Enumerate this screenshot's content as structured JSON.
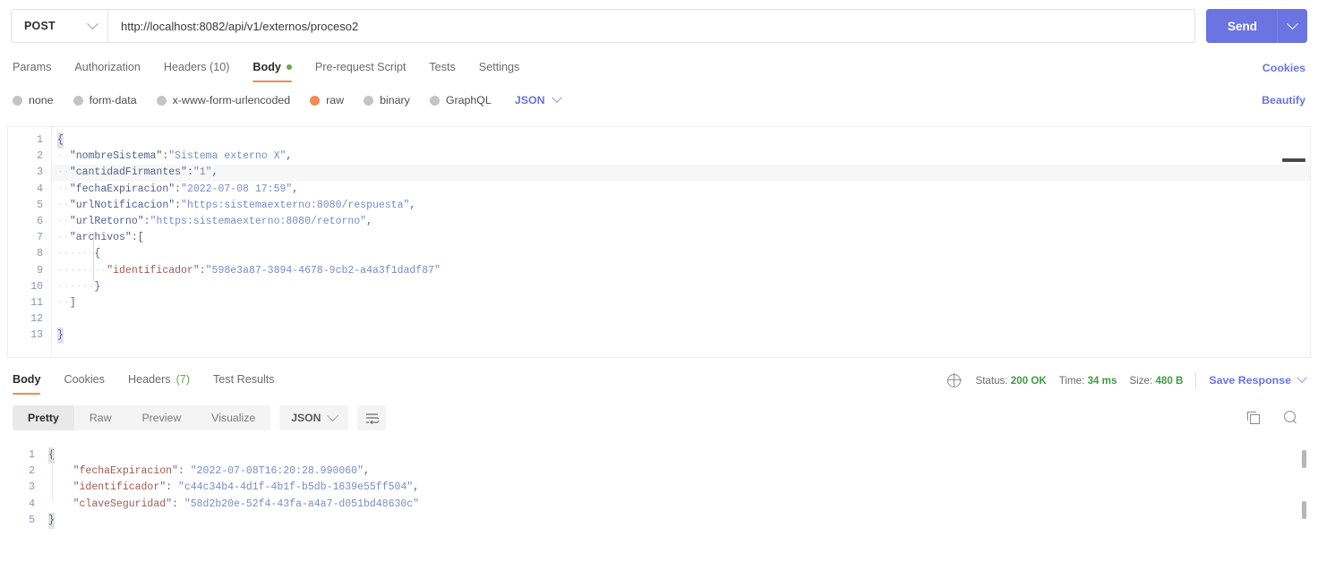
{
  "request_bar": {
    "method": "POST",
    "url": "http://localhost:8082/api/v1/externos/proceso2",
    "send_label": "Send"
  },
  "request_tabs": {
    "items": [
      {
        "label": "Params",
        "active": false
      },
      {
        "label": "Authorization",
        "active": false
      },
      {
        "label": "Headers (10)",
        "active": false
      },
      {
        "label": "Body",
        "active": true,
        "dot": true
      },
      {
        "label": "Pre-request Script",
        "active": false
      },
      {
        "label": "Tests",
        "active": false
      },
      {
        "label": "Settings",
        "active": false
      }
    ],
    "cookies_link": "Cookies"
  },
  "body_type": {
    "options": [
      {
        "label": "none",
        "selected": false
      },
      {
        "label": "form-data",
        "selected": false
      },
      {
        "label": "x-www-form-urlencoded",
        "selected": false
      },
      {
        "label": "raw",
        "selected": true
      },
      {
        "label": "binary",
        "selected": false
      },
      {
        "label": "GraphQL",
        "selected": false
      }
    ],
    "format": "JSON",
    "beautify_link": "Beautify"
  },
  "request_editor": {
    "line_numbers": [
      "1",
      "2",
      "3",
      "4",
      "5",
      "6",
      "7",
      "8",
      "9",
      "10",
      "11",
      "12",
      "13"
    ],
    "lines": [
      {
        "n": 1,
        "content": "{"
      },
      {
        "n": 2,
        "content": "··\"nombreSistema\":\"Sistema externo X\","
      },
      {
        "n": 3,
        "content": "··\"cantidadFirmantes\":\"1\","
      },
      {
        "n": 4,
        "content": "··\"fechaExpiracion\":\"2022-07-08 17:59\","
      },
      {
        "n": 5,
        "content": "··\"urlNotificacion\":\"https:sistemaexterno:8080/respuesta\","
      },
      {
        "n": 6,
        "content": "··\"urlRetorno\":\"https:sistemaexterno:8080/retorno\","
      },
      {
        "n": 7,
        "content": "··\"archivos\":["
      },
      {
        "n": 8,
        "content": "······{"
      },
      {
        "n": 9,
        "content": "········\"identificador\":\"598e3a87-3894-4678-9cb2-a4a3f1dadf87\""
      },
      {
        "n": 10,
        "content": "······}"
      },
      {
        "n": 11,
        "content": "··]"
      },
      {
        "n": 12,
        "content": ""
      },
      {
        "n": 13,
        "content": "}"
      }
    ],
    "keys": {
      "nombreSistema": "\"nombreSistema\"",
      "cantidadFirmantes": "\"cantidadFirmantes\"",
      "fechaExpiracion": "\"fechaExpiracion\"",
      "urlNotificacion": "\"urlNotificacion\"",
      "urlRetorno": "\"urlRetorno\"",
      "archivos": "\"archivos\"",
      "identificador": "\"identificador\""
    },
    "values": {
      "nombreSistema": "\"Sistema externo X\"",
      "cantidadFirmantes": "\"1\"",
      "fechaExpiracion": "\"2022-07-08 17:59\"",
      "urlNotificacion": "\"https:sistemaexterno:8080/respuesta\"",
      "urlRetorno": "\"https:sistemaexterno:8080/retorno\"",
      "identificador": "\"598e3a87-3894-4678-9cb2-a4a3f1dadf87\""
    }
  },
  "response_tabs": {
    "items": [
      {
        "label": "Body",
        "active": true
      },
      {
        "label": "Cookies",
        "active": false
      },
      {
        "label": "Headers (7)",
        "active": false,
        "count": "(7)"
      },
      {
        "label": "Test Results",
        "active": false
      }
    ],
    "headers_text": "Headers",
    "headers_count": "(7)"
  },
  "response_meta": {
    "status_label": "Status:",
    "status_value": "200 OK",
    "time_label": "Time:",
    "time_value": "34 ms",
    "size_label": "Size:",
    "size_value": "480 B",
    "save_response": "Save Response"
  },
  "response_toolbar": {
    "views": [
      {
        "label": "Pretty",
        "active": true
      },
      {
        "label": "Raw",
        "active": false
      },
      {
        "label": "Preview",
        "active": false
      },
      {
        "label": "Visualize",
        "active": false
      }
    ],
    "format": "JSON"
  },
  "response_body": {
    "line_numbers": [
      "1",
      "2",
      "3",
      "4",
      "5"
    ],
    "keys": {
      "fechaExpiracion": "\"fechaExpiracion\"",
      "identificador": "\"identificador\"",
      "claveSeguridad": "\"claveSeguridad\""
    },
    "values": {
      "fechaExpiracion": "\"2022-07-08T16:20:28.990060\"",
      "identificador": "\"c44c34b4-4d1f-4b1f-b5db-1639e55ff504\"",
      "claveSeguridad": "\"58d2b20e-52f4-43fa-a4a7-d051bd48630c\""
    },
    "open_brace": "{",
    "close_brace": "}",
    "comma": ",",
    "colon": ": "
  },
  "colors": {
    "accent_blue": "#6b74e0",
    "active_underline": "#ef8b53",
    "status_green": "#3f9c43",
    "radio_selected": "#ef8b53",
    "json_key": "#555d8f",
    "json_key_resp": "#9e5b53",
    "json_value": "#7a8bc4"
  }
}
